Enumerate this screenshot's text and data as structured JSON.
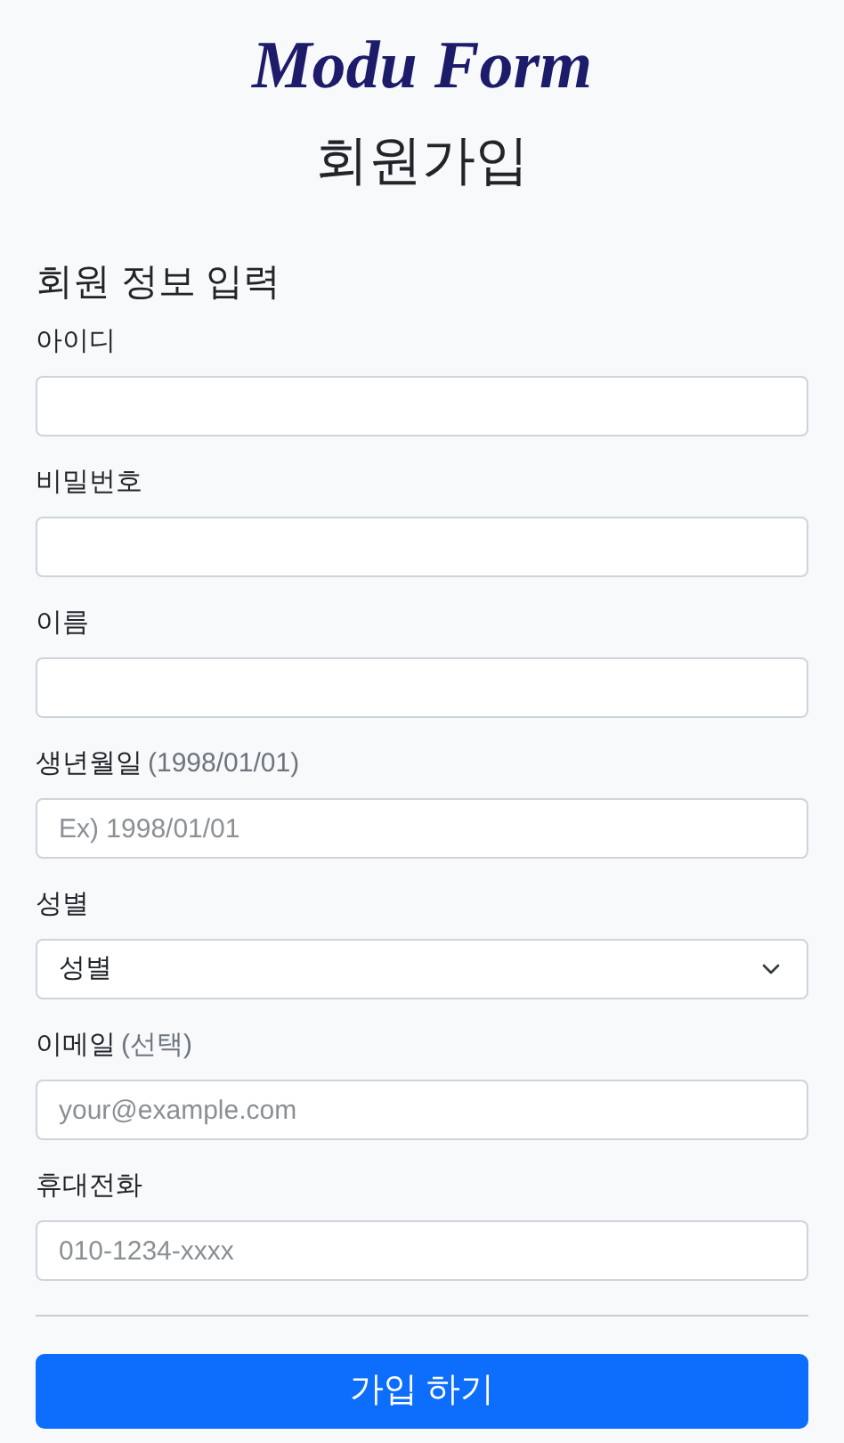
{
  "logo": "Modu Form",
  "title": "회원가입",
  "section_title": "회원 정보 입력",
  "fields": [
    {
      "kind": "input",
      "label": "아이디"
    },
    {
      "kind": "input",
      "label": "비밀번호"
    },
    {
      "kind": "input",
      "label": "이름"
    },
    {
      "kind": "input",
      "label": "생년월일",
      "hint": "(1998/01/01)",
      "placeholder": "Ex) 1998/01/01"
    },
    {
      "kind": "select",
      "label": "성별",
      "value": "성별"
    },
    {
      "kind": "input",
      "label": "이메일",
      "hint": "(선택)",
      "placeholder": "your@example.com"
    },
    {
      "kind": "input",
      "label": "휴대전화",
      "placeholder": "010-1234-xxxx"
    }
  ],
  "submit_button": "가입 하기"
}
